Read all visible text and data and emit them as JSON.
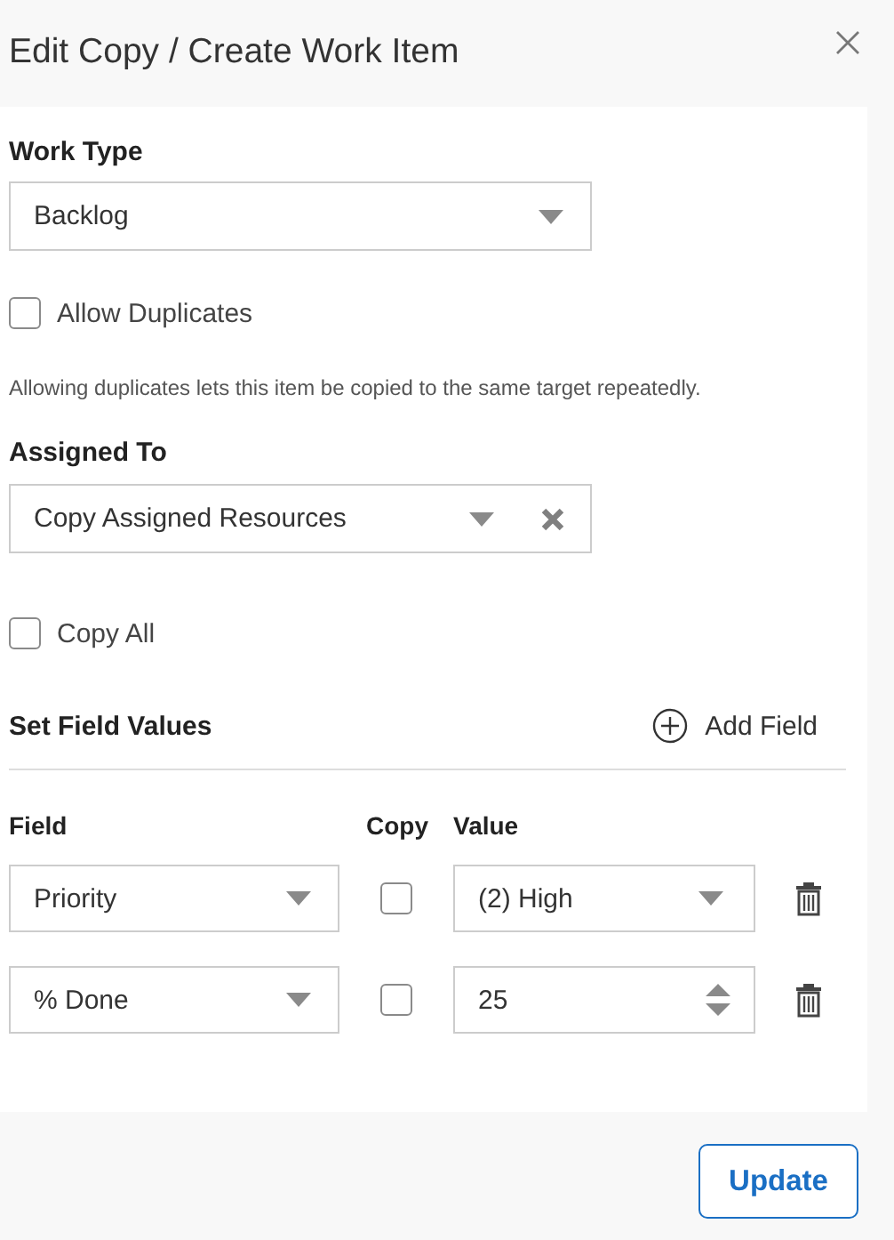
{
  "dialog": {
    "title": "Edit Copy / Create Work Item"
  },
  "work_type": {
    "label": "Work Type",
    "value": "Backlog"
  },
  "allow_duplicates": {
    "label": "Allow Duplicates",
    "checked": false
  },
  "help_text": "Allowing duplicates lets this item be copied to the same target repeatedly.",
  "assigned_to": {
    "label": "Assigned To",
    "value": "Copy Assigned Resources"
  },
  "copy_all": {
    "label": "Copy All",
    "checked": false
  },
  "field_values": {
    "title": "Set Field Values",
    "add_button": "Add Field",
    "columns": [
      "Field",
      "Copy",
      "Value"
    ],
    "rows": [
      {
        "field": "Priority",
        "copy": false,
        "kind": "dropdown",
        "value": "(2) High"
      },
      {
        "field": "% Done",
        "copy": false,
        "kind": "number",
        "value": "25"
      }
    ]
  },
  "buttons": [
    "Update"
  ]
}
